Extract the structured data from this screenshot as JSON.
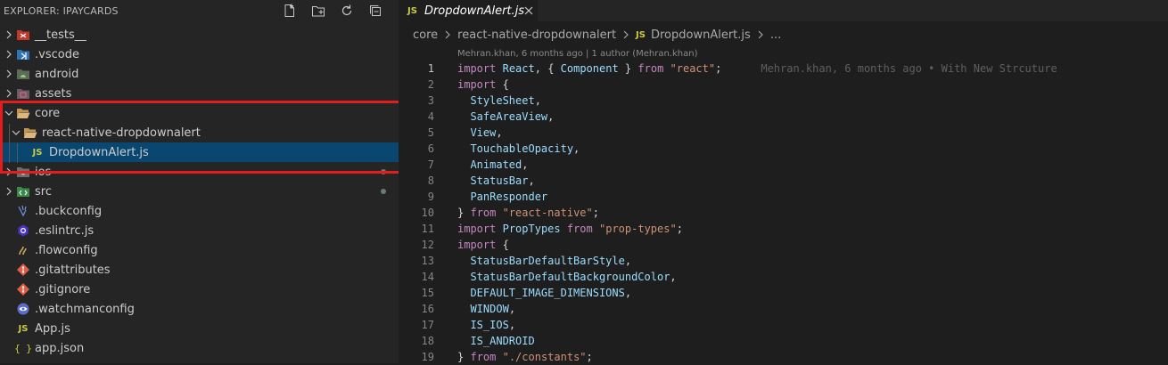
{
  "explorer": {
    "title": "EXPLORER: IPAYCARDS",
    "actions": [
      "new-file-icon",
      "new-folder-icon",
      "refresh-icon",
      "collapse-all-icon"
    ],
    "items": [
      {
        "label": "__tests__",
        "type": "folder",
        "expanded": false,
        "icon": "tests-folder-icon",
        "level": 0
      },
      {
        "label": ".vscode",
        "type": "folder",
        "expanded": false,
        "icon": "vscode-folder-icon",
        "level": 0
      },
      {
        "label": "android",
        "type": "folder",
        "expanded": false,
        "icon": "android-folder-icon",
        "level": 0
      },
      {
        "label": "assets",
        "type": "folder",
        "expanded": false,
        "icon": "assets-folder-icon",
        "level": 0
      },
      {
        "label": "core",
        "type": "folder",
        "expanded": true,
        "icon": "folder-open-icon",
        "level": 0
      },
      {
        "label": "react-native-dropdownalert",
        "type": "folder",
        "expanded": true,
        "icon": "folder-open-icon",
        "level": 1
      },
      {
        "label": "DropdownAlert.js",
        "type": "file",
        "icon": "js-file-icon",
        "level": 2,
        "selected": true
      },
      {
        "label": "ios",
        "type": "folder",
        "expanded": false,
        "icon": "ios-folder-icon",
        "level": 0,
        "modified": true
      },
      {
        "label": "src",
        "type": "folder",
        "expanded": false,
        "icon": "src-folder-icon",
        "level": 0,
        "modified": true
      },
      {
        "label": ".buckconfig",
        "type": "file",
        "icon": "buck-file-icon",
        "level": 0
      },
      {
        "label": ".eslintrc.js",
        "type": "file",
        "icon": "eslint-file-icon",
        "level": 0
      },
      {
        "label": ".flowconfig",
        "type": "file",
        "icon": "flow-file-icon",
        "level": 0
      },
      {
        "label": ".gitattributes",
        "type": "file",
        "icon": "git-file-icon",
        "level": 0
      },
      {
        "label": ".gitignore",
        "type": "file",
        "icon": "git-file-icon",
        "level": 0
      },
      {
        "label": ".watchmanconfig",
        "type": "file",
        "icon": "watchman-file-icon",
        "level": 0
      },
      {
        "label": "App.js",
        "type": "file",
        "icon": "js-file-icon",
        "level": 0
      },
      {
        "label": "app.json",
        "type": "file",
        "icon": "json-file-icon",
        "level": 0
      }
    ]
  },
  "editor": {
    "tab": {
      "label": "DropdownAlert.js",
      "badge": "JS"
    },
    "breadcrumbs": [
      "core",
      "react-native-dropdownalert",
      "DropdownAlert.js",
      "..."
    ],
    "breadcrumb_badge": "JS",
    "blame_header": "Mehran.khan, 6 months ago | 1 author (Mehran.khan)",
    "blame_inline": "Mehran.khan, 6 months ago • With New Strcuture",
    "active_line": 1,
    "lines": [
      "import React, { Component } from \"react\";",
      "import {",
      "  StyleSheet,",
      "  SafeAreaView,",
      "  View,",
      "  TouchableOpacity,",
      "  Animated,",
      "  StatusBar,",
      "  PanResponder",
      "} from \"react-native\";",
      "import PropTypes from \"prop-types\";",
      "import {",
      "  StatusBarDefaultBarStyle,",
      "  StatusBarDefaultBackgroundColor,",
      "  DEFAULT_IMAGE_DIMENSIONS,",
      "  WINDOW,",
      "  IS_IOS,",
      "  IS_ANDROID",
      "} from \"./constants\";"
    ]
  },
  "colors": {
    "selection": "#094771",
    "highlight_box": "#e51c1c",
    "js_badge": "#cbcb41"
  }
}
